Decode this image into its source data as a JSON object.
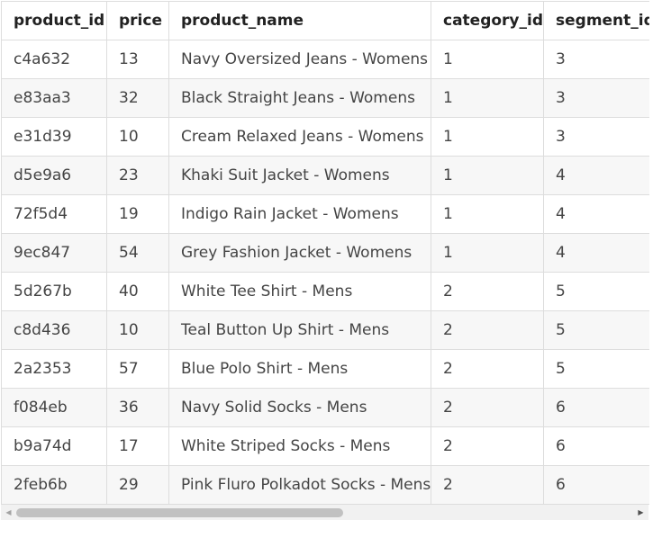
{
  "table": {
    "columns": [
      "product_id",
      "price",
      "product_name",
      "category_id",
      "segment_id"
    ],
    "rows": [
      [
        "c4a632",
        "13",
        "Navy Oversized Jeans - Womens",
        "1",
        "3"
      ],
      [
        "e83aa3",
        "32",
        "Black Straight Jeans - Womens",
        "1",
        "3"
      ],
      [
        "e31d39",
        "10",
        "Cream Relaxed Jeans - Womens",
        "1",
        "3"
      ],
      [
        "d5e9a6",
        "23",
        "Khaki Suit Jacket - Womens",
        "1",
        "4"
      ],
      [
        "72f5d4",
        "19",
        "Indigo Rain Jacket - Womens",
        "1",
        "4"
      ],
      [
        "9ec847",
        "54",
        "Grey Fashion Jacket - Womens",
        "1",
        "4"
      ],
      [
        "5d267b",
        "40",
        "White Tee Shirt - Mens",
        "2",
        "5"
      ],
      [
        "c8d436",
        "10",
        "Teal Button Up Shirt - Mens",
        "2",
        "5"
      ],
      [
        "2a2353",
        "57",
        "Blue Polo Shirt - Mens",
        "2",
        "5"
      ],
      [
        "f084eb",
        "36",
        "Navy Solid Socks - Mens",
        "2",
        "6"
      ],
      [
        "b9a74d",
        "17",
        "White Striped Socks - Mens",
        "2",
        "6"
      ],
      [
        "2feb6b",
        "29",
        "Pink Fluro Polkadot Socks - Mens",
        "2",
        "6"
      ]
    ]
  },
  "scrollbar": {
    "left_arrow_icon": "chevron-left-icon",
    "right_arrow_icon": "chevron-right-icon",
    "thumb_fraction": 0.53
  }
}
